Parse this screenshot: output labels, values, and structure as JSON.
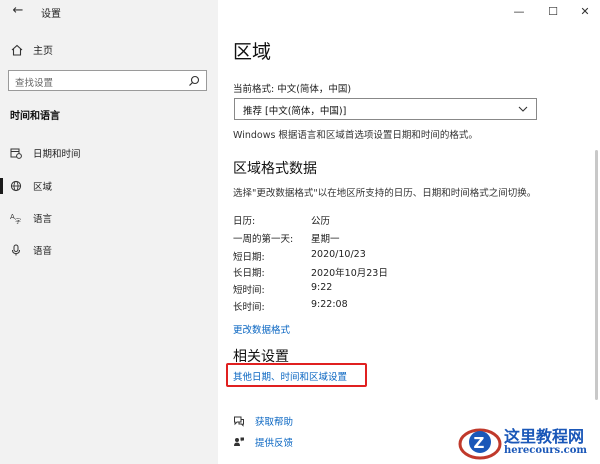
{
  "window": {
    "back_glyph": "←",
    "title": "设置",
    "minimize_glyph": "—",
    "maximize_glyph": "☐",
    "close_glyph": "✕"
  },
  "sidebar": {
    "home_label": "主页",
    "search_placeholder": "查找设置",
    "section_title": "时间和语言",
    "items": [
      {
        "label": "日期和时间",
        "icon": "calendar-clock-icon"
      },
      {
        "label": "区域",
        "icon": "globe-icon",
        "active": true
      },
      {
        "label": "语言",
        "icon": "language-icon"
      },
      {
        "label": "语音",
        "icon": "microphone-icon"
      }
    ]
  },
  "main": {
    "title": "区域",
    "current_format_label": "当前格式: 中文(简体，中国)",
    "format_dropdown_value": "推荐 [中文(简体，中国)]",
    "format_description": "Windows 根据语言和区域首选项设置日期和时间的格式。",
    "region_format_heading": "区域格式数据",
    "region_format_description": "选择\"更改数据格式\"以在地区所支持的日历、日期和时间格式之间切换。",
    "format_rows": [
      {
        "key": "日历:",
        "value": "公历"
      },
      {
        "key": "一周的第一天:",
        "value": "星期一"
      },
      {
        "key": "短日期:",
        "value": "2020/10/23"
      },
      {
        "key": "长日期:",
        "value": "2020年10月23日"
      },
      {
        "key": "短时间:",
        "value": "9:22"
      },
      {
        "key": "长时间:",
        "value": "9:22:08"
      }
    ],
    "change_format_link": "更改数据格式",
    "related_heading": "相关设置",
    "related_link": "其他日期、时间和区域设置",
    "help_link": "获取帮助",
    "feedback_link": "提供反馈"
  },
  "watermark": {
    "line1": "这里教程网",
    "line2": "herecours.com"
  },
  "colors": {
    "accent_link": "#0a66c2",
    "highlight_border": "#e02020",
    "sidebar_bg": "#f2f2f2"
  }
}
